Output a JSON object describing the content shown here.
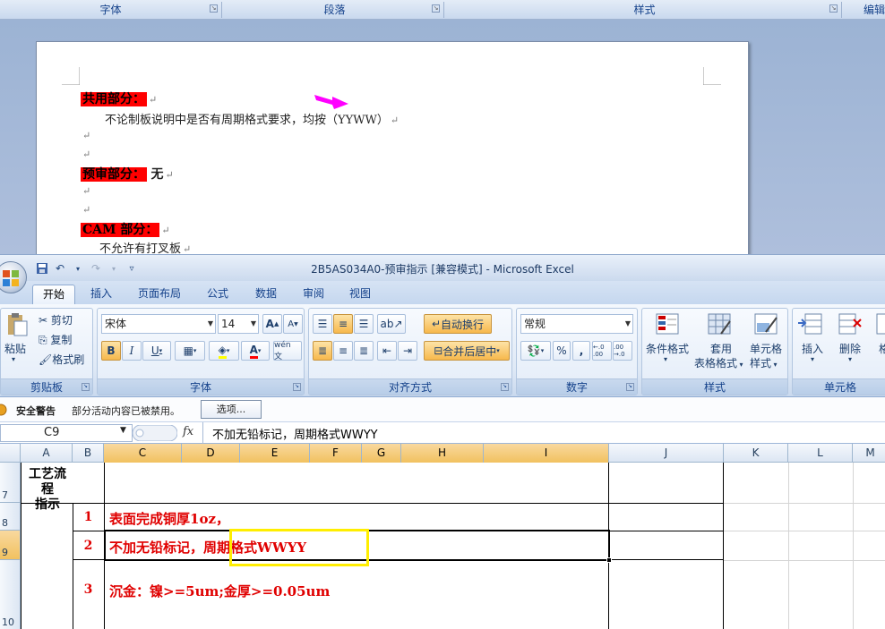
{
  "word": {
    "groups": [
      "字体",
      "段落",
      "样式",
      "编辑"
    ],
    "lines": [
      {
        "label": "共用部分：",
        "text": ""
      },
      {
        "label": "",
        "text": "不论制板说明中是否有周期格式要求，均按（YYWW）"
      },
      {
        "label": "预审部分：",
        "text": "无"
      },
      {
        "label": "CAM 部分：",
        "text": ""
      },
      {
        "label": "",
        "text": "不允许有打叉板"
      }
    ],
    "para_mark": "↵",
    "arrow_color": "#ff00ff"
  },
  "excel": {
    "title": "2B5AS034A0-预审指示  [兼容模式] - Microsoft Excel",
    "tabs": [
      "开始",
      "插入",
      "页面布局",
      "公式",
      "数据",
      "审阅",
      "视图"
    ],
    "active_tab": "开始",
    "clipboard": {
      "paste": "粘贴",
      "cut": "剪切",
      "copy": "复制",
      "format_painter": "格式刷",
      "label": "剪贴板"
    },
    "font": {
      "name": "宋体",
      "size": "14",
      "label": "字体",
      "grow": "A",
      "shrink": "A",
      "bold": "B",
      "italic": "I",
      "underline": "U",
      "font_color": "A",
      "wen": "wén 文"
    },
    "alignment": {
      "wrap": "自动换行",
      "merge": "合并后居中",
      "label": "对齐方式"
    },
    "number": {
      "format": "常规",
      "percent": "%",
      "comma": ",",
      "inc": "←.0 .00",
      "dec": ".00 →.0",
      "label": "数字"
    },
    "styles": {
      "cond": "条件格式",
      "table1": "套用",
      "table2": "表格格式",
      "cell1": "单元格",
      "cell2": "样式",
      "label": "样式"
    },
    "cells": {
      "insert": "插入",
      "delete": "删除",
      "format": "格",
      "label": "单元格"
    },
    "security": {
      "title": "安全警告",
      "message": "部分活动内容已被禁用。",
      "options": "选项..."
    },
    "name_box": "C9",
    "fx": "fx",
    "formula": "不加无铅标记，周期格式WWYY",
    "columns": [
      "A",
      "B",
      "C",
      "D",
      "E",
      "F",
      "G",
      "H",
      "I",
      "J",
      "K",
      "L",
      "M"
    ],
    "rows": [
      "7",
      "8",
      "9",
      "10"
    ],
    "cells_content": {
      "a7": "工艺流程\n指示",
      "b8": "1",
      "c8": "表面完成铜厚1oz，",
      "b9": "2",
      "c9a": "不加无铅标记，",
      "c9b": "周期格式WWYY",
      "b10": "3",
      "c10": "沉金：镍>=5um;金厚>=0.05um"
    },
    "highlight_color": "#ffee00",
    "text_red": "#e00000"
  }
}
